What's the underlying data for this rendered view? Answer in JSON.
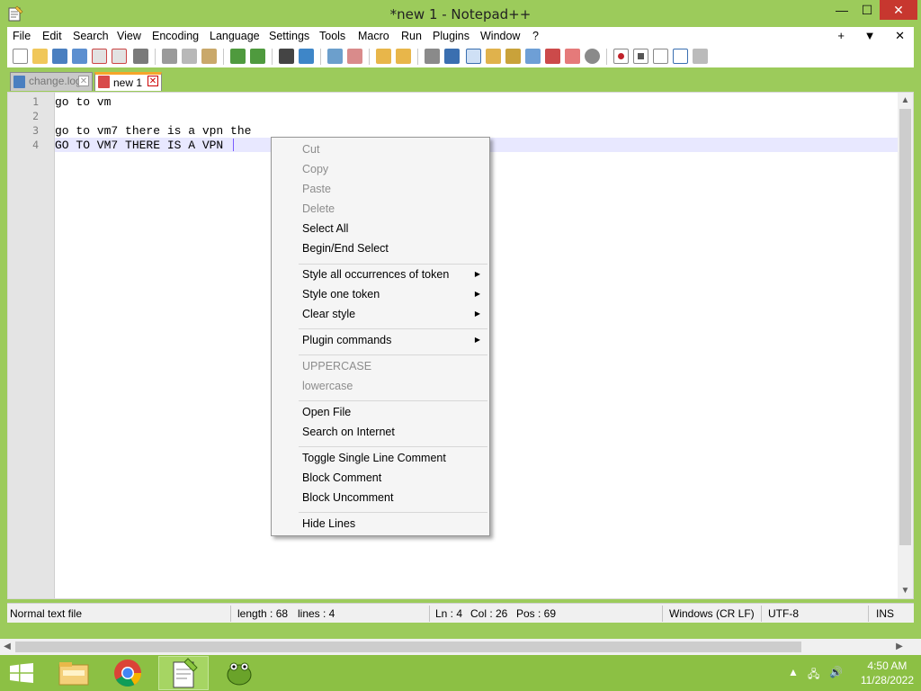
{
  "window": {
    "title": "*new 1 - Notepad++"
  },
  "menu": {
    "items": [
      "File",
      "Edit",
      "Search",
      "View",
      "Encoding",
      "Language",
      "Settings",
      "Tools",
      "Macro",
      "Run",
      "Plugins",
      "Window",
      "?"
    ],
    "right": [
      "+",
      "▼",
      "✕"
    ]
  },
  "tabs": [
    {
      "label": "change.log",
      "active": false
    },
    {
      "label": "new 1",
      "active": true
    }
  ],
  "editor": {
    "lines": [
      {
        "no": "1",
        "text": "go to vm"
      },
      {
        "no": "2",
        "text": ""
      },
      {
        "no": "3",
        "text": "go to vm7 there is a vpn the"
      },
      {
        "no": "4",
        "text": "GO TO VM7 THERE IS A VPN "
      }
    ]
  },
  "context_menu": {
    "items": [
      {
        "label": "Cut",
        "disabled": true
      },
      {
        "label": "Copy",
        "disabled": true
      },
      {
        "label": "Paste",
        "disabled": true
      },
      {
        "label": "Delete",
        "disabled": true
      },
      {
        "label": "Select All",
        "disabled": false
      },
      {
        "label": "Begin/End Select",
        "disabled": false
      },
      {
        "label": "Style all occurrences of token",
        "disabled": false,
        "submenu": true
      },
      {
        "label": "Style one token",
        "disabled": false,
        "submenu": true
      },
      {
        "label": "Clear style",
        "disabled": false,
        "submenu": true
      },
      {
        "label": "Plugin commands",
        "disabled": false,
        "submenu": true
      },
      {
        "label": "UPPERCASE",
        "disabled": true
      },
      {
        "label": "lowercase",
        "disabled": true
      },
      {
        "label": "Open File",
        "disabled": false
      },
      {
        "label": "Search on Internet",
        "disabled": false
      },
      {
        "label": "Toggle Single Line Comment",
        "disabled": false
      },
      {
        "label": "Block Comment",
        "disabled": false
      },
      {
        "label": "Block Uncomment",
        "disabled": false
      },
      {
        "label": "Hide Lines",
        "disabled": false
      }
    ]
  },
  "status": {
    "filetype": "Normal text file",
    "length": "length : 68",
    "lines": "lines : 4",
    "ln": "Ln : 4",
    "col": "Col : 26",
    "pos": "Pos : 69",
    "eol": "Windows (CR LF)",
    "encoding": "UTF-8",
    "mode": "INS"
  },
  "taskbar": {
    "time": "4:50 AM",
    "date": "11/28/2022"
  },
  "colors": {
    "frame": "#9ccb5b",
    "taskbar": "#8cc044",
    "close": "#c7372f",
    "active_tab_accent": "#f6a52a",
    "caret": "#7a5cff"
  }
}
